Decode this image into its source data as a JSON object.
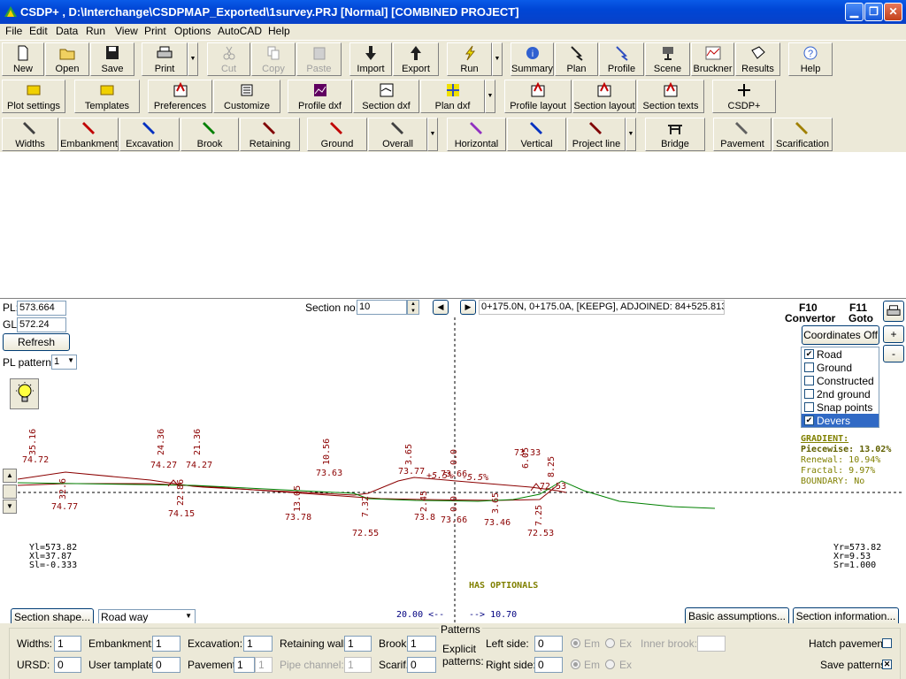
{
  "window": {
    "title": "CSDP+ , D:\\Interchange\\CSDPMAP_Exported\\1survey.PRJ [Normal] [COMBINED PROJECT]",
    "minimize_icon": "minimize-icon",
    "maximize_icon": "restore-icon",
    "close_icon": "close-icon"
  },
  "menu": [
    "File",
    "Edit",
    "Data",
    "Run",
    "View",
    "Print",
    "Options",
    "AutoCAD",
    "Help"
  ],
  "toolbar1": [
    {
      "label": "New",
      "icon": "new-file-icon",
      "enabled": true
    },
    {
      "label": "Open",
      "icon": "open-folder-icon",
      "enabled": true
    },
    {
      "label": "Save",
      "icon": "floppy-disk-icon",
      "enabled": true
    },
    {
      "label": "Print",
      "icon": "printer-icon",
      "enabled": true
    },
    {
      "label": "Cut",
      "icon": "scissors-icon",
      "enabled": false
    },
    {
      "label": "Copy",
      "icon": "copy-icon",
      "enabled": false
    },
    {
      "label": "Paste",
      "icon": "paste-icon",
      "enabled": false
    },
    {
      "label": "Import",
      "icon": "import-arrow-icon",
      "enabled": true
    },
    {
      "label": "Export",
      "icon": "export-arrow-icon",
      "enabled": true
    },
    {
      "label": "Run",
      "icon": "lightning-icon",
      "enabled": true
    },
    {
      "label": "Summary",
      "icon": "info-icon",
      "enabled": true
    },
    {
      "label": "Plan",
      "icon": "plan-icon",
      "enabled": true
    },
    {
      "label": "Profile",
      "icon": "profile-icon",
      "enabled": true
    },
    {
      "label": "Scene",
      "icon": "scene-icon",
      "enabled": true
    },
    {
      "label": "Bruckner",
      "icon": "bruckner-chart-icon",
      "enabled": true
    },
    {
      "label": "Results",
      "icon": "results-icon",
      "enabled": true
    },
    {
      "label": "Help",
      "icon": "help-icon",
      "enabled": true
    }
  ],
  "toolbar2": [
    {
      "label": "Plot settings",
      "icon": "plot-settings-icon"
    },
    {
      "label": "Templates",
      "icon": "templates-icon"
    },
    {
      "label": "Preferences",
      "icon": "preferences-icon"
    },
    {
      "label": "Customize",
      "icon": "customize-icon"
    },
    {
      "label": "Profile dxf",
      "icon": "profile-dxf-icon"
    },
    {
      "label": "Section dxf",
      "icon": "section-dxf-icon"
    },
    {
      "label": "Plan dxf",
      "icon": "plan-dxf-icon"
    },
    {
      "label": "Profile layout",
      "icon": "profile-layout-icon"
    },
    {
      "label": "Section layout",
      "icon": "section-layout-icon"
    },
    {
      "label": "Section texts",
      "icon": "section-texts-icon"
    },
    {
      "label": "CSDP+",
      "icon": "plus-icon"
    }
  ],
  "toolbar3": [
    {
      "label": "Widths",
      "icon": "pencil-icon",
      "color": "#404040"
    },
    {
      "label": "Embankment",
      "icon": "pencil-icon",
      "color": "#c00000"
    },
    {
      "label": "Excavation",
      "icon": "pencil-icon",
      "color": "#0030c0"
    },
    {
      "label": "Brook",
      "icon": "pencil-icon",
      "color": "#008000"
    },
    {
      "label": "Retaining",
      "icon": "pencil-icon",
      "color": "#800000"
    },
    {
      "label": "Ground",
      "icon": "pencil-icon",
      "color": "#c00000"
    },
    {
      "label": "Overall",
      "icon": "pencil-icon",
      "color": "#404040"
    },
    {
      "label": "Horizontal",
      "icon": "pencil-icon",
      "color": "#9030c0"
    },
    {
      "label": "Vertical",
      "icon": "pencil-icon",
      "color": "#0030c0"
    },
    {
      "label": "Project line",
      "icon": "pencil-icon",
      "color": "#800000"
    },
    {
      "label": "Bridge",
      "icon": "bridge-icon",
      "color": "#404040"
    },
    {
      "label": "Pavement",
      "icon": "pencil-icon",
      "color": "#606060"
    },
    {
      "label": "Scarification",
      "icon": "pencil-icon",
      "color": "#a08000"
    }
  ],
  "section": {
    "pl_label": "PL:",
    "pl_value": "573.664",
    "gl_label": "GL:",
    "gl_value": "572.24",
    "refresh_label": "Refresh",
    "pl_pattern_label": "PL pattern:",
    "pl_pattern_value": "1",
    "section_no_label": "Section no.:",
    "section_no_value": "10",
    "station_text": "0+175.0N, 0+175.0A, [KEEPG], ADJOINED: 84+525.813",
    "f10_key": "F10",
    "f10_label": "Convertor",
    "f11_key": "F11",
    "f11_label": "Goto",
    "coords_label": "Coordinates Off",
    "zoom_in": "+",
    "zoom_out": "-",
    "print_icon": "printer-icon",
    "bulb_icon": "lightbulb-icon",
    "layers": [
      {
        "label": "Road",
        "checked": true,
        "selected": false
      },
      {
        "label": "Ground",
        "checked": false,
        "selected": false
      },
      {
        "label": "Constructed",
        "checked": false,
        "selected": false
      },
      {
        "label": "2nd ground",
        "checked": false,
        "selected": false
      },
      {
        "label": "Snap points",
        "checked": false,
        "selected": false
      },
      {
        "label": "Devers",
        "checked": true,
        "selected": true
      }
    ],
    "gradient": {
      "title": "GRADIENT:",
      "piecewise": "Piecewise: 13.02%",
      "renewal": "Renewal: 10.94%",
      "fractal": "Fractal:  9.97%",
      "boundary": "BOUNDARY: No"
    },
    "left_info": [
      "Yl=573.82",
      "Xl=37.87",
      "Sl=-0.333"
    ],
    "right_info": [
      "Yr=573.82",
      "Xr=9.53",
      "Sr=1.000"
    ],
    "has_optionals": "HAS OPTIONALS",
    "width_left": "20.00 <--",
    "width_right": "--> 10.70",
    "drawing_labels": {
      "top": [
        "35.16",
        "24.36",
        "21.36",
        "10.56",
        "3.65",
        "0.0",
        "6.05",
        "8.25"
      ],
      "mid": [
        "74.72",
        "74.27",
        "74.27",
        "73.63",
        "73.77",
        "+5.5%",
        "73.66",
        "-5.5%",
        "73.33",
        "72.53"
      ],
      "low": [
        "32.6",
        "22.86",
        "13.05",
        "7.32",
        "2.45",
        "0.0",
        "3.65",
        "7.25"
      ],
      "bottom": [
        "74.77",
        "74.15",
        "73.78",
        "72.55",
        "73.8",
        "73.66",
        "73.46",
        "72.53"
      ]
    }
  },
  "bottom": {
    "section_shape_label": "Section shape...",
    "roadway_value": "Road way",
    "basic_assumptions_label": "Basic assumptions...",
    "section_information_label": "Section information...",
    "widths_label": "Widths:",
    "widths_value": "1",
    "embankment_label": "Embankment:",
    "embankment_value": "1",
    "excavation_label": "Excavation:",
    "excavation_value": "1",
    "retaining_label": "Retaining wall:",
    "retaining_value": "1",
    "brook_label": "Brook:",
    "brook_value": "1",
    "ursd_label": "URSD:",
    "ursd_value": "0",
    "user_template_label": "User tamplate:",
    "user_template_value": "0",
    "pavement_label": "Pavement:",
    "pavement_value": "1",
    "pavement_value2": "1",
    "pipe_label": "Pipe channel:",
    "pipe_value": "1",
    "scarif_label": "Scarif.:",
    "scarif_value": "0",
    "patterns_title": "Patterns",
    "explicit_label1": "Explicit",
    "explicit_label2": "patterns:",
    "left_side_label": "Left side:",
    "left_side_value": "0",
    "right_side_label": "Right side:",
    "right_side_value": "0",
    "em_label": "Em",
    "ex_label": "Ex",
    "inner_brook_label": "Inner brook:",
    "hatch_label": "Hatch pavement",
    "save_label": "Save patterns"
  },
  "colors": {
    "road": "#8b0000",
    "ground": "#008000",
    "gradient": "#808000"
  }
}
